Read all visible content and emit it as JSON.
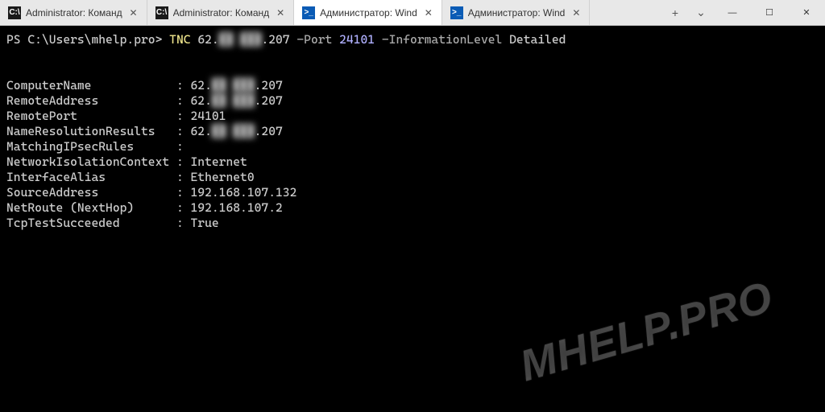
{
  "tabs": [
    {
      "icon": "cmd",
      "glyph": "C:\\",
      "label": "Administrator: Команд",
      "active": false
    },
    {
      "icon": "cmd",
      "glyph": "C:\\",
      "label": "Administrator: Команд",
      "active": false
    },
    {
      "icon": "ps",
      "glyph": ">_",
      "label": "Администратор: Wind",
      "active": true
    },
    {
      "icon": "ps",
      "glyph": ">_",
      "label": "Администратор: Wind",
      "active": false
    }
  ],
  "titlebar": {
    "add": "+",
    "dropdown": "⌄",
    "minimize": "—",
    "maximize": "☐",
    "close": "✕",
    "tab_close": "✕"
  },
  "prompt": "PS C:\\Users\\mhelp.pro> ",
  "command": {
    "cmd": "TNC",
    "ip_prefix": "62.",
    "ip_blur": "██ ███",
    "ip_suffix": ".207",
    "param_port": "-Port",
    "port": "24101",
    "param_info": "-InformationLevel",
    "info_val": "Detailed"
  },
  "results": [
    {
      "key": "ComputerName",
      "val_prefix": "62.",
      "val_blur": "██ ███",
      "val_suffix": ".207"
    },
    {
      "key": "RemoteAddress",
      "val_prefix": "62.",
      "val_blur": "██ ███",
      "val_suffix": ".207"
    },
    {
      "key": "RemotePort",
      "val": "24101"
    },
    {
      "key": "NameResolutionResults",
      "val_prefix": "62.",
      "val_blur": "██ ███",
      "val_suffix": ".207"
    },
    {
      "key": "MatchingIPsecRules",
      "val": ""
    },
    {
      "key": "NetworkIsolationContext",
      "val": "Internet"
    },
    {
      "key": "InterfaceAlias",
      "val": "Ethernet0"
    },
    {
      "key": "SourceAddress",
      "val": "192.168.107.132"
    },
    {
      "key": "NetRoute (NextHop)",
      "val": "192.168.107.2"
    },
    {
      "key": "TcpTestSucceeded",
      "val": "True"
    }
  ],
  "key_column_width": 24,
  "watermark": "MHELP.PRO"
}
